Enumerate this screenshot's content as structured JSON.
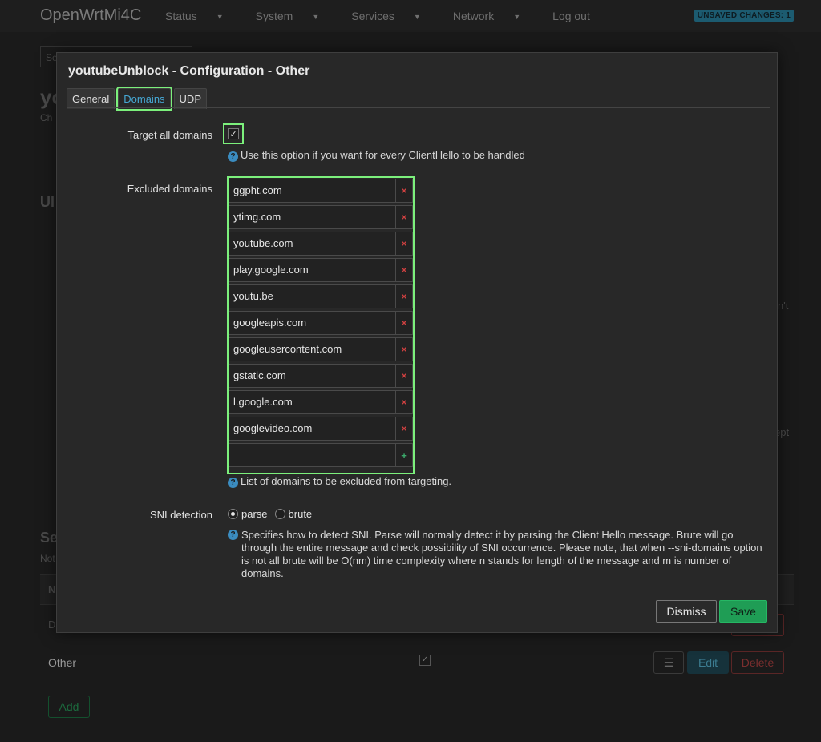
{
  "header": {
    "brand": "OpenWrtMi4C",
    "nav": [
      "Status",
      "System",
      "Services",
      "Network"
    ],
    "logout": "Log out",
    "unsaved": "UNSAVED CHANGES: 1"
  },
  "background": {
    "tab_fragment": "Se",
    "title_fragment": "yo",
    "sub_fragment": "Ch",
    "section_fragment": "UI",
    "side_fragment_1": "n't",
    "side_fragment_2": "ept",
    "section2_fragment": "Se",
    "note_fragment": "Not",
    "col_fragment": "N",
    "row_fragment": "D",
    "row_other": "Other",
    "edit_label": "Edit",
    "delete_label": "Delete",
    "menu_icon": "☰",
    "add_label": "Add"
  },
  "modal": {
    "title": "youtubeUnblock - Configuration - Other",
    "tabs": [
      {
        "label": "General"
      },
      {
        "label": "Domains"
      },
      {
        "label": "UDP"
      }
    ],
    "target_all": {
      "label": "Target all domains",
      "checked": true,
      "help": "Use this option if you want for every ClientHello to be handled"
    },
    "excluded": {
      "label": "Excluded domains",
      "domains": [
        "ggpht.com",
        "ytimg.com",
        "youtube.com",
        "play.google.com",
        "youtu.be",
        "googleapis.com",
        "googleusercontent.com",
        "gstatic.com",
        "l.google.com",
        "googlevideo.com"
      ],
      "new_value": "",
      "remove_symbol": "×",
      "add_symbol": "+",
      "help": "List of domains to be excluded from targeting."
    },
    "sni": {
      "label": "SNI detection",
      "options": [
        "parse",
        "brute"
      ],
      "selected": "parse",
      "help": "Specifies how to detect SNI. Parse will normally detect it by parsing the Client Hello message. Brute will go through the entire message and check possibility of SNI occurrence. Please note, that when --sni-domains option is not all brute will be O(nm) time complexity where n stands for length of the message and m is number of domains."
    },
    "dismiss_label": "Dismiss",
    "save_label": "Save"
  },
  "colors": {
    "accent_green": "#7cf07c",
    "save_green": "#1f9d55",
    "tab_active_blue": "#46a8d4",
    "remove_red": "#d04040"
  }
}
